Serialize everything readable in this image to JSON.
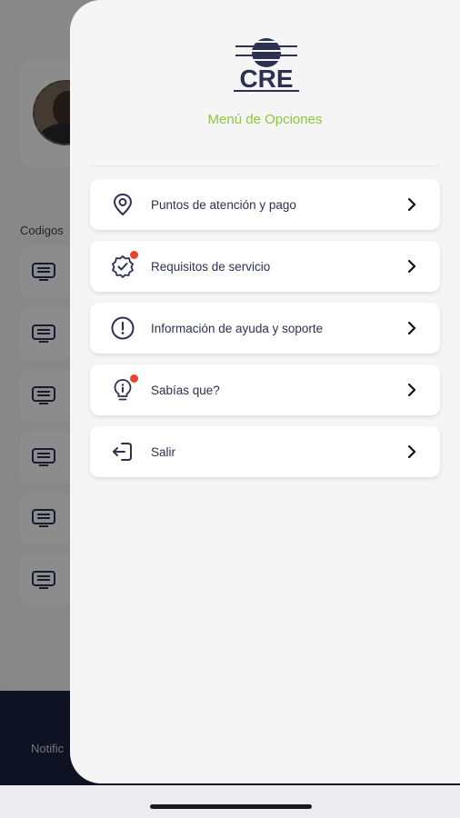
{
  "background": {
    "codes_label": "Codigos",
    "nav_label": "Notific"
  },
  "drawer": {
    "logo_text": "CRE",
    "title": "Menú de Opciones",
    "items": [
      {
        "label": "Puntos de atención y pago",
        "icon": "location-pin-icon",
        "badge": false
      },
      {
        "label": "Requisitos de servicio",
        "icon": "verified-badge-icon",
        "badge": true
      },
      {
        "label": "Información de ayuda y soporte",
        "icon": "info-exclamation-icon",
        "badge": false
      },
      {
        "label": "Sabías que?",
        "icon": "lightbulb-info-icon",
        "badge": true
      },
      {
        "label": "Salir",
        "icon": "logout-icon",
        "badge": false
      }
    ]
  },
  "colors": {
    "accent_green": "#8cc63f",
    "brand_navy": "#2c3152",
    "badge_red": "#e8442e",
    "nav_bg": "#1c2240"
  }
}
